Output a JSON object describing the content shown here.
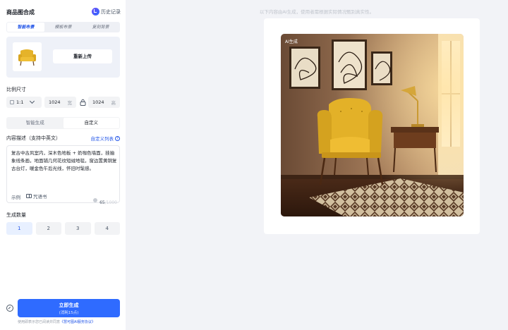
{
  "app": {
    "title": "商品图合成",
    "history_label": "历史记录"
  },
  "mode_tabs": [
    {
      "label": "智能布景",
      "active": true
    },
    {
      "label": "模板布景",
      "active": false
    },
    {
      "label": "复刻背景",
      "active": false
    }
  ],
  "upload": {
    "reupload_label": "重新上传"
  },
  "ratio": {
    "label": "比例尺寸",
    "selected": "1:1",
    "width": "1024",
    "width_unit": "宽",
    "height": "1024",
    "height_unit": "高"
  },
  "desc_tabs": [
    {
      "label": "智能生成",
      "active": false
    },
    {
      "label": "自定义",
      "active": true
    }
  ],
  "description": {
    "label": "内容描述（支持中英文）",
    "custom_list_label": "自定义列表",
    "text": "复古中古风室内，深木色地板 + 奶咖色墙面，挂抽象线条画，地面铺几何花纹短绒地毯，窗边置黄铜复古台灯，暖金色午后光线，怀旧时髦感。",
    "example_label": "示例",
    "spellbook_label": "咒语书",
    "count_current": "65",
    "count_max": "/1000"
  },
  "quantity": {
    "label": "生成数量",
    "options": [
      "1",
      "2",
      "3",
      "4"
    ],
    "selected_index": 0
  },
  "generate": {
    "label": "立即生成",
    "cost": "(消耗15点)",
    "agreement_prefix": "使用即表示您已阅读并同意",
    "agreement_link": "《慧可图AI服务协议》"
  },
  "preview": {
    "hint": "以下内容由AI生成，使用者需根据实际情况甄别真实性。",
    "badge": "AI生成"
  },
  "colors": {
    "accent": "#2f6bff",
    "link": "#2255e8",
    "chair": "#e0b12a"
  }
}
